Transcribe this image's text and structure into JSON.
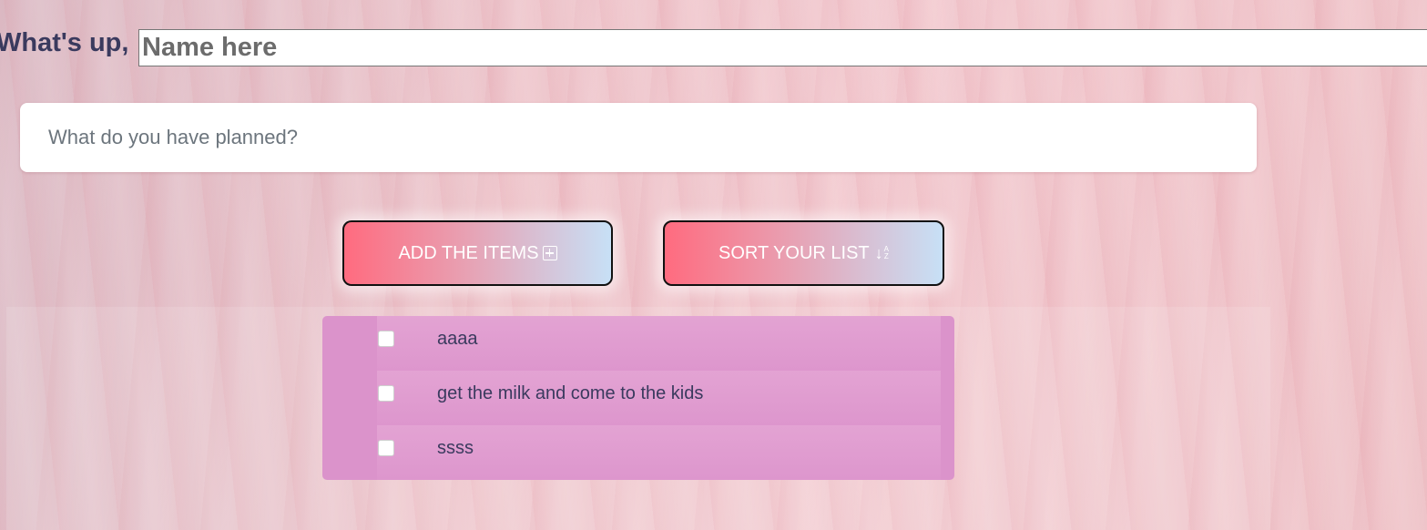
{
  "header": {
    "greeting": "What's up,",
    "name_placeholder": "Name here"
  },
  "new_todo": {
    "placeholder": "What do you have planned?"
  },
  "buttons": {
    "add_label": "ADD THE ITEMS",
    "add_icon": "plus-square-icon",
    "sort_label": "SORT YOUR LIST",
    "sort_icon": "sort-alpha-down-icon"
  },
  "todos": [
    {
      "text": "aaaa",
      "done": false
    },
    {
      "text": "get the milk and come to the kids",
      "done": false
    },
    {
      "text": "ssss",
      "done": false
    }
  ],
  "colors": {
    "button_gradient_start": "#ff6b7f",
    "button_gradient_end": "#c7e0f6",
    "list_panel": "#db93cb",
    "text_dark": "#3a3a5e"
  }
}
